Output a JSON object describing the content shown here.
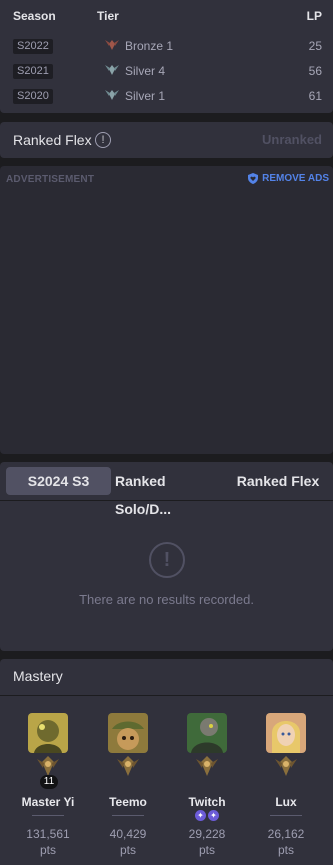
{
  "season_table": {
    "headers": {
      "season": "Season",
      "tier": "Tier",
      "lp": "LP"
    },
    "rows": [
      {
        "season": "S2022",
        "tier": "Bronze 1",
        "lp": "25",
        "emblem": "bronze-emblem-icon",
        "emblem_color": "#a0574a"
      },
      {
        "season": "S2021",
        "tier": "Silver 4",
        "lp": "56",
        "emblem": "silver-emblem-icon",
        "emblem_color": "#8aa3a8"
      },
      {
        "season": "S2020",
        "tier": "Silver 1",
        "lp": "61",
        "emblem": "silver-emblem-icon",
        "emblem_color": "#8aa3a8"
      }
    ]
  },
  "ranked_flex": {
    "title": "Ranked Flex",
    "info_icon": "!",
    "status": "Unranked"
  },
  "ad": {
    "label": "ADVERTISEMENT",
    "remove": "REMOVE ADS"
  },
  "tabs": {
    "items": [
      {
        "label": "S2024 S3",
        "active": true
      },
      {
        "label": "Ranked Solo/D...",
        "active": false
      },
      {
        "label": "Ranked Flex",
        "active": false
      }
    ],
    "empty_icon": "!",
    "empty_message": "There are no results recorded."
  },
  "mastery": {
    "title": "Mastery",
    "champions": [
      {
        "name": "Master Yi",
        "points": "131,561",
        "unit": "pts",
        "level": "11",
        "portrait_color": "#b9a548"
      },
      {
        "name": "Teemo",
        "points": "40,429",
        "unit": "pts",
        "portrait_color": "#8e7a3c"
      },
      {
        "name": "Twitch",
        "points": "29,228",
        "unit": "pts",
        "tokens": [
          "✦",
          "✦"
        ],
        "portrait_color": "#3f6a3a"
      },
      {
        "name": "Lux",
        "points": "26,162",
        "unit": "pts",
        "portrait_color": "#d8a77a"
      }
    ]
  },
  "colors": {
    "accent": "#5383e8",
    "panel": "#31313c",
    "background": "#1c1c1f"
  }
}
